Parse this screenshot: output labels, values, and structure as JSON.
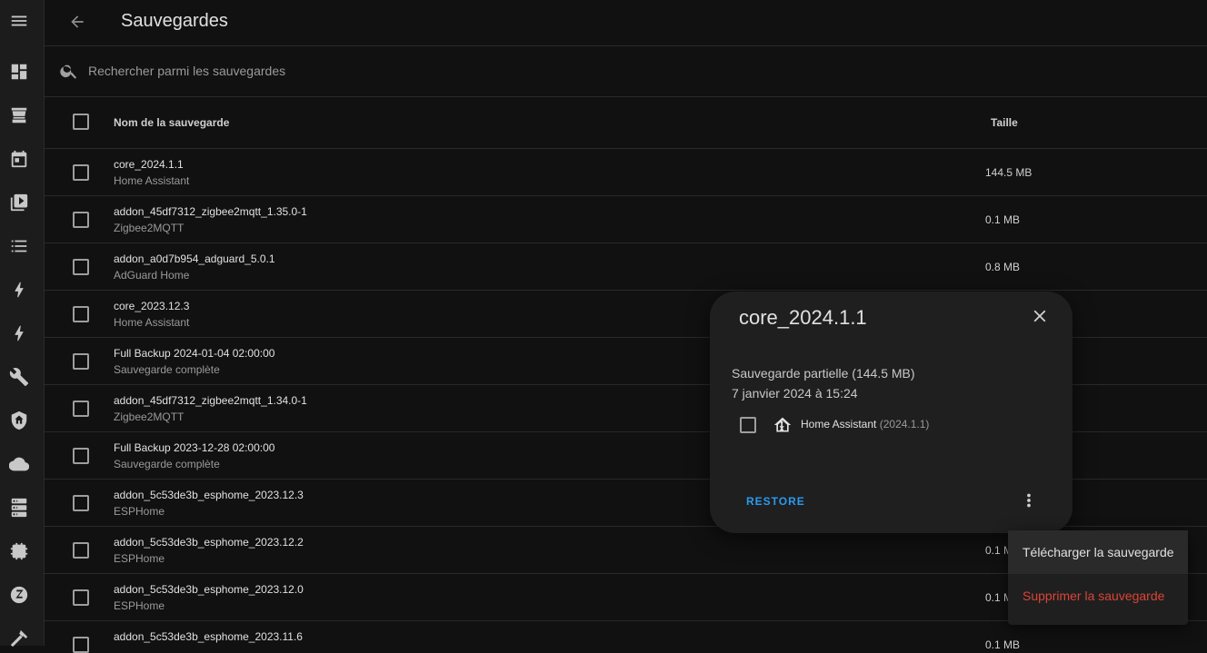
{
  "header": {
    "title": "Sauvegardes"
  },
  "search": {
    "placeholder": "Rechercher parmi les sauvegardes"
  },
  "table": {
    "columns": {
      "name": "Nom de la sauvegarde",
      "size": "Taille"
    },
    "rows": [
      {
        "name": "core_2024.1.1",
        "sub": "Home Assistant",
        "size": "144.5 MB"
      },
      {
        "name": "addon_45df7312_zigbee2mqtt_1.35.0-1",
        "sub": "Zigbee2MQTT",
        "size": "0.1 MB"
      },
      {
        "name": "addon_a0d7b954_adguard_5.0.1",
        "sub": "AdGuard Home",
        "size": "0.8 MB"
      },
      {
        "name": "core_2023.12.3",
        "sub": "Home Assistant",
        "size": ""
      },
      {
        "name": "Full Backup 2024-01-04 02:00:00",
        "sub": "Sauvegarde complète",
        "size": ""
      },
      {
        "name": "addon_45df7312_zigbee2mqtt_1.34.0-1",
        "sub": "Zigbee2MQTT",
        "size": ""
      },
      {
        "name": "Full Backup 2023-12-28 02:00:00",
        "sub": "Sauvegarde complète",
        "size": ""
      },
      {
        "name": "addon_5c53de3b_esphome_2023.12.3",
        "sub": "ESPHome",
        "size": ""
      },
      {
        "name": "addon_5c53de3b_esphome_2023.12.2",
        "sub": "ESPHome",
        "size": "0.1 M"
      },
      {
        "name": "addon_5c53de3b_esphome_2023.12.0",
        "sub": "ESPHome",
        "size": "0.1 M"
      },
      {
        "name": "addon_5c53de3b_esphome_2023.11.6",
        "sub": "",
        "size": "0.1 MB"
      }
    ]
  },
  "dialog": {
    "title": "core_2024.1.1",
    "type": "Sauvegarde partielle (144.5 MB)",
    "date": "7 janvier 2024 à 15:24",
    "item_name": "Home Assistant",
    "item_version": "(2024.1.1)",
    "restore_label": "RESTORE"
  },
  "menu": {
    "download": "Télécharger la sauvegarde",
    "delete": "Supprimer la sauvegarde"
  },
  "colors": {
    "accent": "#2a9bf0",
    "danger": "#db4437"
  },
  "icons": {
    "sidebar": [
      "menu-icon",
      "dashboard-icon",
      "hacs-icon",
      "calendar-icon",
      "media-icon",
      "list-icon",
      "energy-icon",
      "energy-icon",
      "wrench-icon",
      "shield-home-icon",
      "cloud-icon",
      "server-icon",
      "chip-icon",
      "zwave-icon",
      "hammer-icon"
    ]
  }
}
